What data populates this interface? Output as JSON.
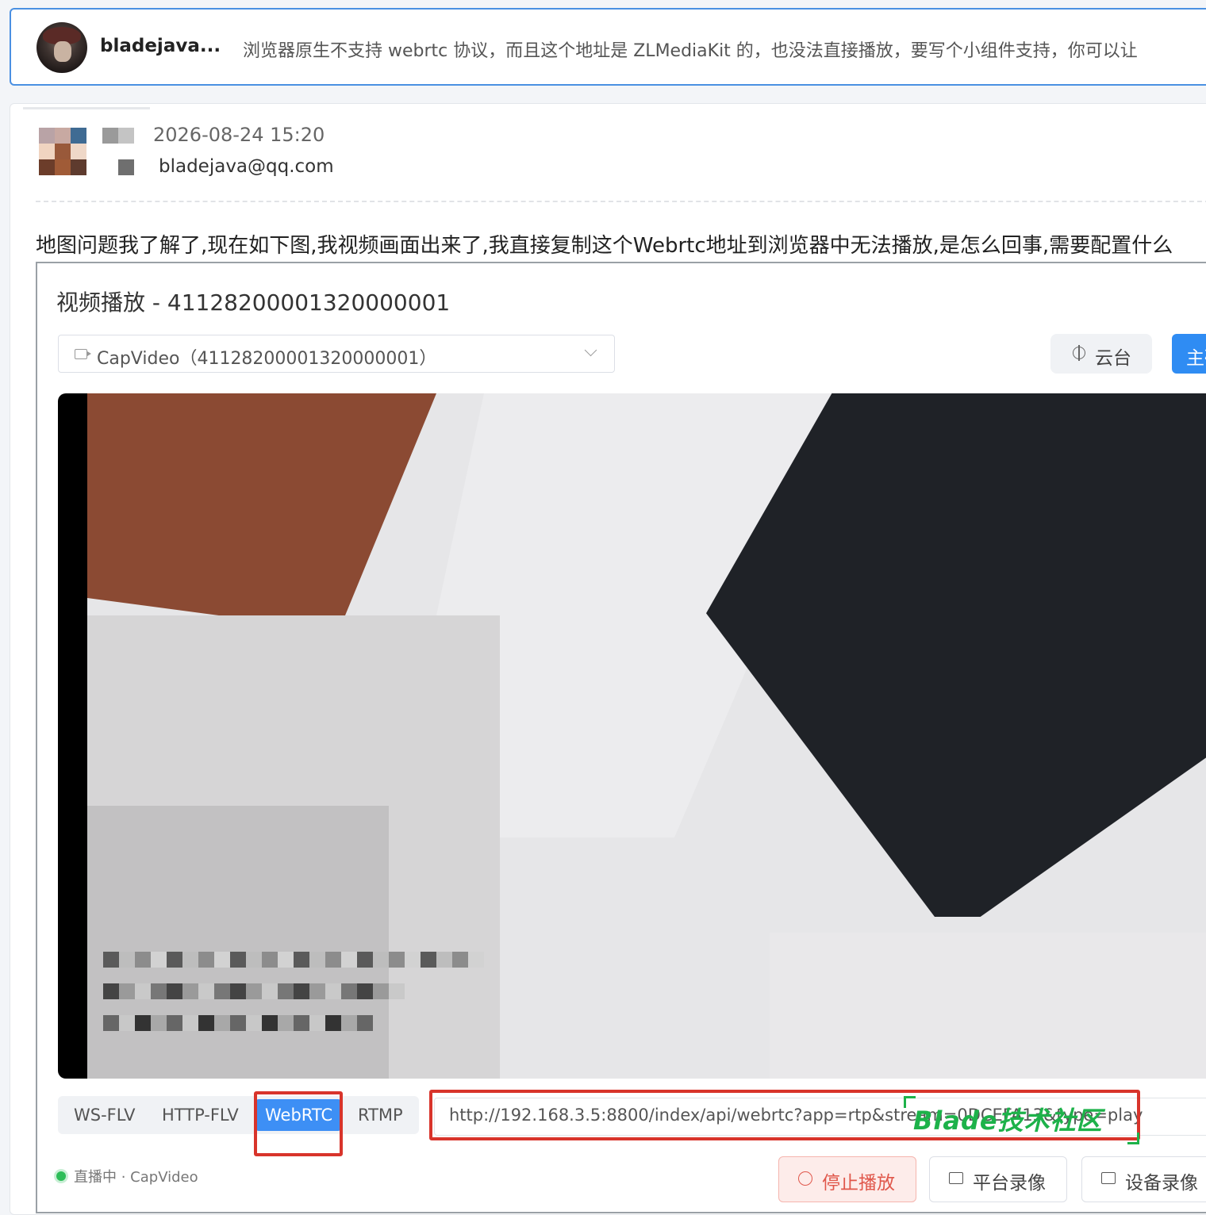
{
  "answer": {
    "username": "bladejava...",
    "text": "浏览器原生不支持 webrtc 协议，而且这个地址是 ZLMediaKit 的，也没法直接播放，要写个小组件支持，你可以让"
  },
  "post": {
    "time": "2026-08-24 15:20",
    "email": "bladejava@qq.com",
    "question": "地图问题我了解了,现在如下图,我视频画面出来了,我直接复制这个Webrtc地址到浏览器中无法播放,是怎么回事,需要配置什么"
  },
  "screenshot": {
    "title": "视频播放 - 41128200001320000001",
    "channel_select": "CapVideo（41128200001320000001）",
    "ptz_button": "云台",
    "main_button": "主码",
    "tabs": [
      "WS-FLV",
      "HTTP-FLV",
      "WebRTC",
      "RTMP"
    ],
    "active_tab": "WebRTC",
    "url": "http://192.168.3.5:8800/index/api/webrtc?app=rtp&stream=0DCEFA13&type=play",
    "watermark": "Blade技术社区",
    "status": "直播中 · CapVideo",
    "buttons": {
      "stop": "停止播放",
      "platform_record": "平台录像",
      "device_record": "设备录像"
    }
  },
  "colors": {
    "accent": "#3d8ff5",
    "highlight_red": "#d8342b",
    "watermark_green": "#1db24a",
    "live_green": "#2ebd59"
  }
}
